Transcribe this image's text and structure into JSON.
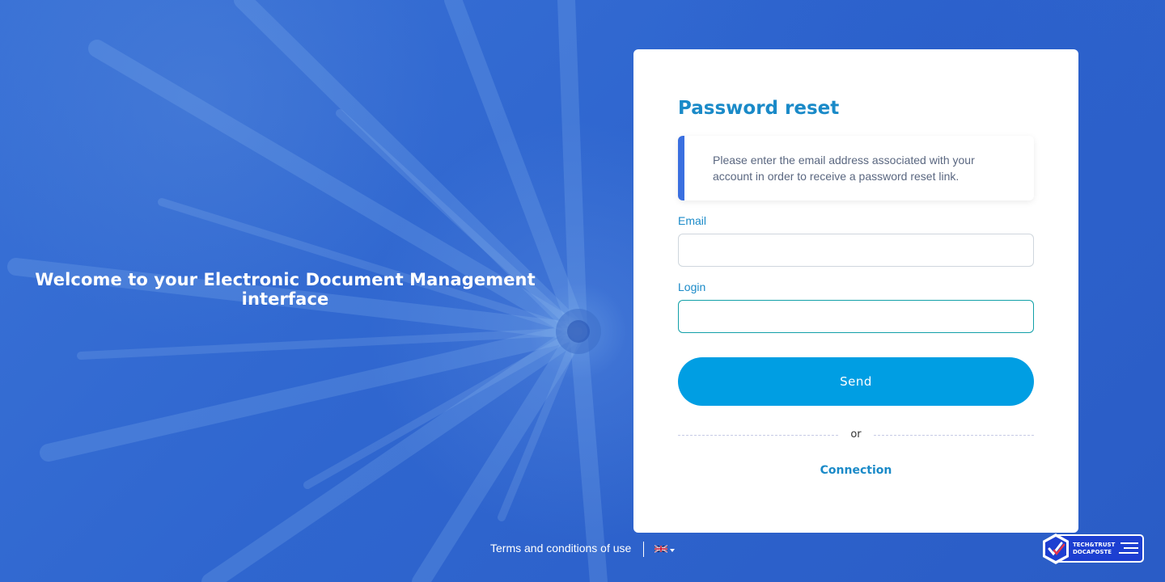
{
  "welcome": {
    "text": "Welcome to your Electronic Document Management interface"
  },
  "form": {
    "title": "Password reset",
    "info": "Please enter the email address associated with your account in order to receive a password reset link.",
    "email_label": "Email",
    "email_value": "",
    "login_label": "Login",
    "login_value": "",
    "send_label": "Send",
    "or_text": "or",
    "connection_label": "Connection"
  },
  "footer": {
    "terms_label": "Terms and conditions of use",
    "language_icon": "uk-flag-icon"
  },
  "badge": {
    "line1": "TECH&TRUST",
    "line2": "DOCAPOSTE"
  },
  "colors": {
    "accent": "#1a8ac8",
    "button": "#009ee3",
    "info_border": "#3a6fe0",
    "background": "#2f67cf"
  }
}
